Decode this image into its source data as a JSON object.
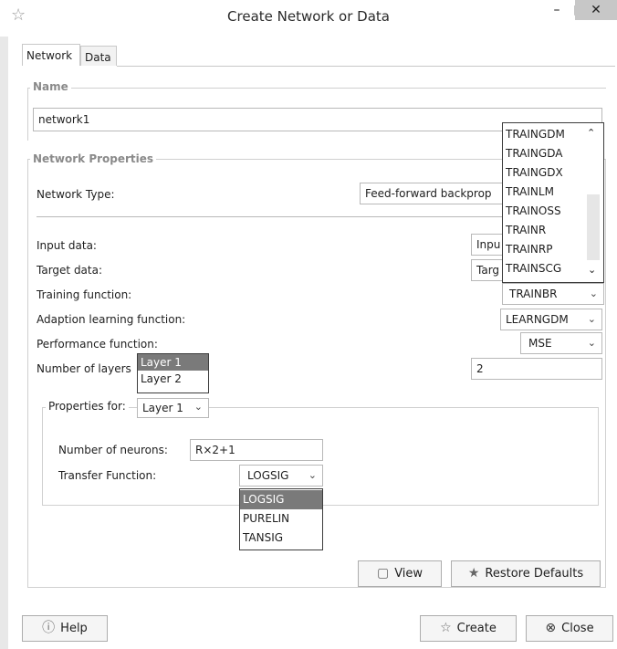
{
  "window": {
    "title": "Create Network or Data",
    "minimize": "–",
    "maximize": "□",
    "close": "✕"
  },
  "tabs": [
    {
      "label": "Network",
      "active": true
    },
    {
      "label": "Data",
      "active": false
    }
  ],
  "name_group": {
    "legend": "Name",
    "value": "network1"
  },
  "props_group": {
    "legend": "Network Properties",
    "network_type_label": "Network Type:",
    "network_type_value": "Feed-forward backprop",
    "input_data_label": "Input data:",
    "input_data_value": "Inpu",
    "target_data_label": "Target data:",
    "target_data_value": "Targ",
    "training_fn_label": "Training function:",
    "training_fn_value": "TRAINBR",
    "adaption_label": "Adaption learning function:",
    "adaption_value": "LEARNGDM",
    "performance_label": "Performance function:",
    "performance_value": "MSE",
    "num_layers_label": "Number of layers",
    "num_layers_value": "2"
  },
  "layer_popup": {
    "items": [
      "Layer 1",
      "Layer 2"
    ],
    "selected": 0
  },
  "training_popup": {
    "items": [
      "TRAINGDM",
      "TRAINGDA",
      "TRAINGDX",
      "TRAINLM",
      "TRAINOSS",
      "TRAINR",
      "TRAINRP",
      "TRAINSCG"
    ]
  },
  "layer_props": {
    "properties_for_label": "Properties for:",
    "properties_for_value": "Layer 1",
    "num_neurons_label": "Number of neurons:",
    "num_neurons_value": "R×2+1",
    "transfer_fn_label": "Transfer Function:",
    "transfer_fn_value": "LOGSIG"
  },
  "transfer_popup": {
    "items": [
      "LOGSIG",
      "PURELIN",
      "TANSIG"
    ],
    "selected": 0
  },
  "buttons": {
    "view": "View",
    "restore_defaults": "Restore Defaults",
    "help": "Help",
    "create": "Create",
    "close": "Close"
  },
  "icons": {
    "app": "star-outline-icon",
    "view": "window-icon",
    "restore": "star-icon",
    "help": "help-icon",
    "create": "star-outline-icon",
    "close": "close-circle-icon"
  },
  "colors": {
    "close_button_bg": "#c7c7c7",
    "popup_selected_bg": "#7a7a7a",
    "group_border": "#d0d0d0"
  }
}
